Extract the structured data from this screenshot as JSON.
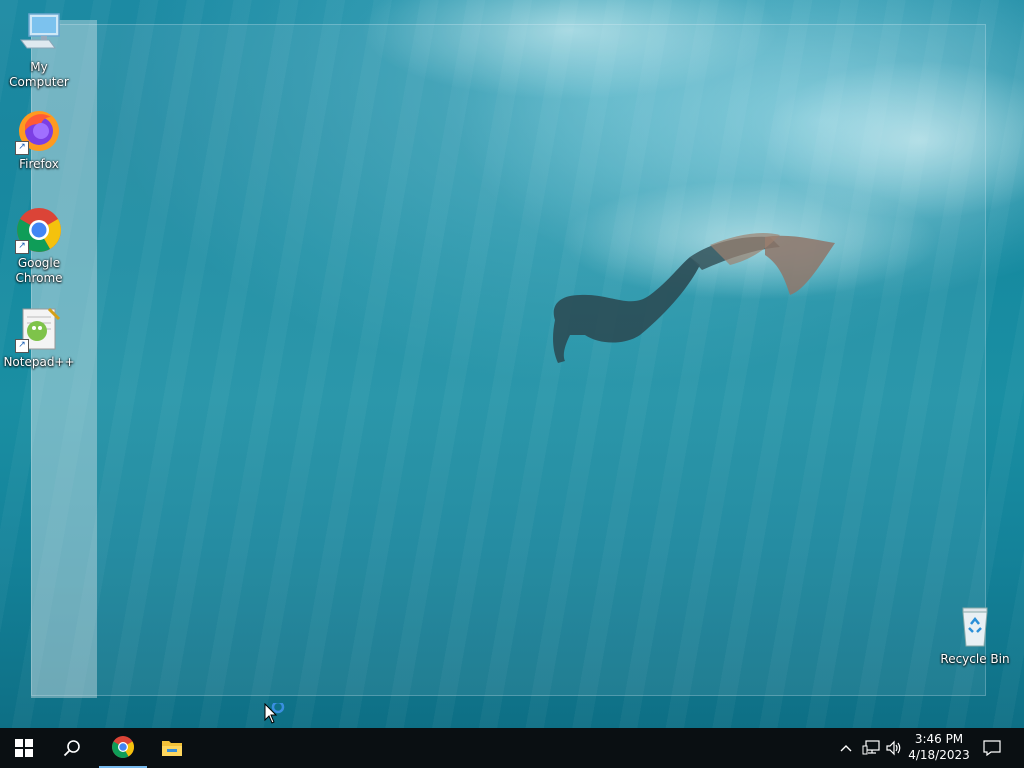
{
  "desktop": {
    "icons": [
      {
        "label": "My Computer",
        "icon": "computer-icon"
      },
      {
        "label": "Firefox",
        "icon": "firefox-icon"
      },
      {
        "label": "Google Chrome",
        "icon": "chrome-icon"
      },
      {
        "label": "Notepad++",
        "icon": "notepadpp-icon"
      },
      {
        "label": "Recycle Bin",
        "icon": "recycle-bin-icon"
      }
    ]
  },
  "taskbar": {
    "start": "windows-start-icon",
    "search": "search-icon",
    "pinned": [
      {
        "name": "Google Chrome",
        "icon": "chrome-icon",
        "active": true
      },
      {
        "name": "File Explorer",
        "icon": "file-explorer-icon",
        "active": false
      }
    ],
    "tray": {
      "icons": [
        "chevron-up-icon",
        "network-icon",
        "volume-icon",
        "notification-icon"
      ],
      "time": "3:46 PM",
      "date": "4/18/2023"
    }
  },
  "colors": {
    "taskbar": "#0a0f12",
    "accent": "#76b9ed",
    "wallpaper": "#1a8aa2"
  }
}
